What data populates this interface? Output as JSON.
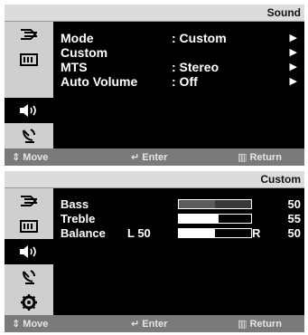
{
  "sound_menu": {
    "title": "Sound",
    "items": [
      {
        "label": "Mode",
        "value": ": Custom",
        "arrow": "▶"
      },
      {
        "label": "Custom",
        "value": "",
        "arrow": "▶"
      },
      {
        "label": "MTS",
        "value": ": Stereo",
        "arrow": "▶"
      },
      {
        "label": "Auto Volume",
        "value": ": Off",
        "arrow": "▶"
      }
    ],
    "footer": {
      "move": "Move",
      "enter": "Enter",
      "return": "Return"
    }
  },
  "custom_menu": {
    "title": "Custom",
    "items": [
      {
        "label": "Bass",
        "value": "50",
        "level": 0.5
      },
      {
        "label": "Treble",
        "value": "55",
        "level": 0.55
      },
      {
        "label": "Balance",
        "left_prefix": "L 50",
        "right_prefix": "R",
        "value": "50",
        "level": 0.5
      }
    ],
    "footer": {
      "move": "Move",
      "enter": "Enter",
      "return": "Return"
    }
  },
  "sidebar_icons": [
    "input-icon",
    "picture-icon",
    "sound-icon",
    "channel-icon",
    "setup-icon"
  ],
  "colors": {
    "title_bg": "#dcdcdc",
    "sidebar_bg": "#cfcfcf",
    "menu_bg": "#000000",
    "footer_bg": "#7a7a7a",
    "text": "#ffffff"
  }
}
